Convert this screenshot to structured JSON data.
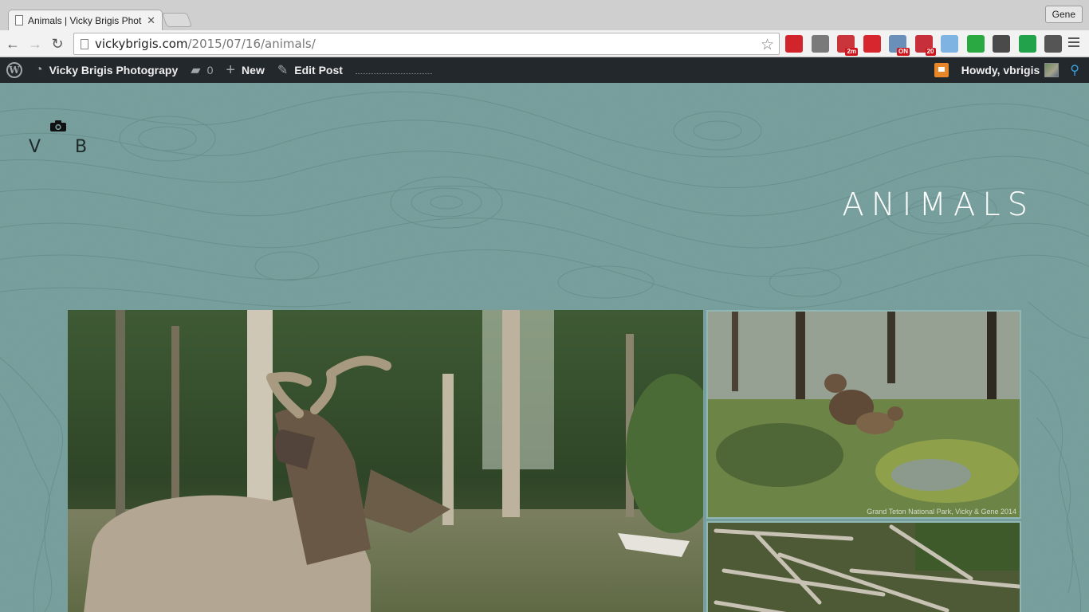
{
  "browser": {
    "tab_title": "Animals | Vicky Brigis Phot",
    "profile_name": "Gene",
    "url_domain": "vickybrigis.com",
    "url_path": "/2015/07/16/animals/",
    "extensions": [
      {
        "icon": "sunburst-ext-icon",
        "color": "#d2242b",
        "badge": ""
      },
      {
        "icon": "pocket-ext-icon",
        "color": "#7a7a7a",
        "badge": ""
      },
      {
        "icon": "timer-ext-icon",
        "color": "#c9353a",
        "badge": "2m"
      },
      {
        "icon": "asterisk-ext-icon",
        "color": "#d8262e",
        "badge": ""
      },
      {
        "icon": "cloud-ext-icon",
        "color": "#6a8fb8",
        "badge": "ON"
      },
      {
        "icon": "lastpass-ext-icon",
        "color": "#c7303a",
        "badge": "20"
      },
      {
        "icon": "camera-ext-icon",
        "color": "#7fb4e2",
        "badge": ""
      },
      {
        "icon": "quote-ext-icon",
        "color": "#2aa842",
        "badge": ""
      },
      {
        "icon": "sync-ext-icon",
        "color": "#4a4a4a",
        "badge": ""
      },
      {
        "icon": "circle-d-ext-icon",
        "color": "#22a24a",
        "badge": ""
      },
      {
        "icon": "h-ext-icon",
        "color": "#555555",
        "badge": ""
      }
    ]
  },
  "adminbar": {
    "site_name": "Vicky Brigis Photograpy",
    "comments_count": "0",
    "new_label": "New",
    "edit_label": "Edit Post",
    "howdy": "Howdy, vbrigis"
  },
  "page": {
    "logo_v": "V",
    "logo_b": "B",
    "title": "ANIMALS",
    "caption": "Grand Teton National Park, Vicky & Gene 2014"
  },
  "colors": {
    "page_bg": "#78a09e",
    "adminbar_bg": "#23282d",
    "accent_blue": "#3aa0de"
  }
}
